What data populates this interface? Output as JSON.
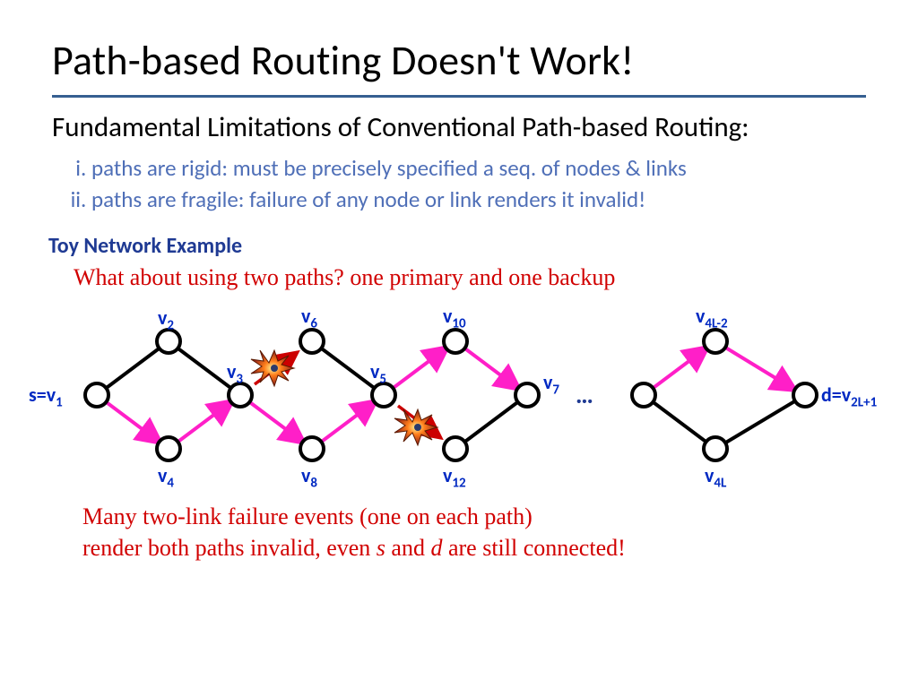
{
  "title": "Path-based Routing Doesn't Work!",
  "subtitle": "Fundamental Limitations of Conventional Path-based Routing:",
  "points": {
    "i": "paths are rigid: must be precisely specified a seq. of nodes & links",
    "ii": "paths are fragile: failure of any node or link renders it invalid!"
  },
  "toy_heading": "Toy Network Example",
  "question": "What about using two paths? one primary and one backup",
  "conclusion_l1": "Many two-link failure events (one on each path)",
  "conclusion_l2_a": "render both paths invalid, even ",
  "conclusion_l2_s": "s",
  "conclusion_l2_b": " and ",
  "conclusion_l2_d": "d",
  "conclusion_l2_c": " are still connected!",
  "labels": {
    "s": "s=v",
    "s_sub": "1",
    "v2": "v",
    "v2_sub": "2",
    "v3": "v",
    "v3_sub": "3",
    "v4": "v",
    "v4_sub": "4",
    "v5": "v",
    "v5_sub": "5",
    "v6": "v",
    "v6_sub": "6",
    "v7": "v",
    "v7_sub": "7",
    "v8": "v",
    "v8_sub": "8",
    "v10": "v",
    "v10_sub": "10",
    "v12": "v",
    "v12_sub": "12",
    "v4lm2": "v",
    "v4lm2_sub": "4L-2",
    "v4l": "v",
    "v4l_sub": "4L",
    "d": "d=v",
    "d_sub": "2L+1",
    "ellipsis": "…"
  },
  "chart_data": {
    "type": "diagram",
    "description": "Toy network: chain of diamond subgraphs from s=v1 to d=v_{2L+1}.",
    "diamonds_shown": 4,
    "nodes": [
      {
        "id": "v1",
        "label": "s=v1"
      },
      {
        "id": "v2"
      },
      {
        "id": "v4"
      },
      {
        "id": "v3"
      },
      {
        "id": "v6"
      },
      {
        "id": "v8"
      },
      {
        "id": "v5"
      },
      {
        "id": "v10"
      },
      {
        "id": "v12"
      },
      {
        "id": "v7"
      },
      {
        "id": "vL_left"
      },
      {
        "id": "v4L-2"
      },
      {
        "id": "v4L"
      },
      {
        "id": "v2L+1",
        "label": "d=v_{2L+1}"
      }
    ],
    "edges": [
      {
        "from": "v1",
        "to": "v2",
        "path": "primary"
      },
      {
        "from": "v2",
        "to": "v3",
        "path": "primary"
      },
      {
        "from": "v1",
        "to": "v4",
        "path": "backup"
      },
      {
        "from": "v4",
        "to": "v3",
        "path": "backup"
      },
      {
        "from": "v3",
        "to": "v6",
        "path": "primary",
        "failed": true
      },
      {
        "from": "v6",
        "to": "v5",
        "path": "primary"
      },
      {
        "from": "v3",
        "to": "v8",
        "path": "backup"
      },
      {
        "from": "v8",
        "to": "v5",
        "path": "backup"
      },
      {
        "from": "v5",
        "to": "v10",
        "path": "backup"
      },
      {
        "from": "v10",
        "to": "v7",
        "path": "backup"
      },
      {
        "from": "v5",
        "to": "v12",
        "path": "primary",
        "failed": true
      },
      {
        "from": "v12",
        "to": "v7",
        "path": "primary"
      },
      {
        "from": "vL_left",
        "to": "v4L-2",
        "path": "backup"
      },
      {
        "from": "v4L-2",
        "to": "v2L+1",
        "path": "backup"
      },
      {
        "from": "vL_left",
        "to": "v4L",
        "path": "primary"
      },
      {
        "from": "v4L",
        "to": "v2L+1",
        "path": "primary"
      }
    ],
    "paths": {
      "primary": "black",
      "backup": "magenta"
    },
    "failures": [
      "v3-v6",
      "v5-v12"
    ]
  }
}
